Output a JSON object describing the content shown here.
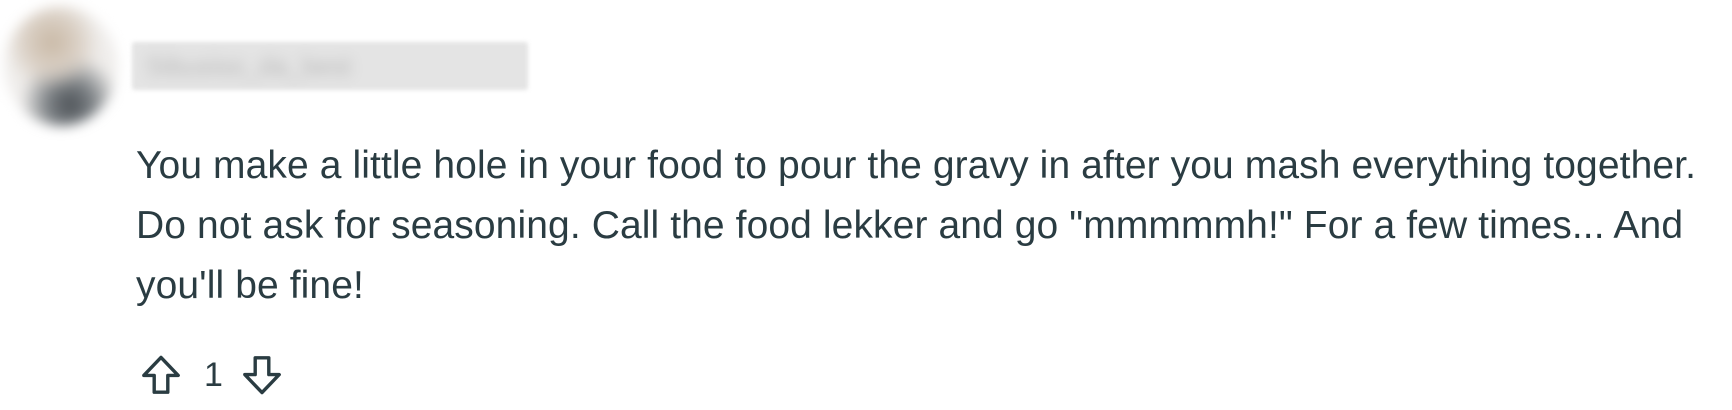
{
  "comment": {
    "author": "Sibusiso_da_best",
    "body": "You make a little hole in your food to pour the gravy in after you mash everything together. Do not ask for seasoning. Call the food lekker and go \"mmmmmh!\" For a few times... And you'll be fine!",
    "votes": {
      "upvote_icon": "upvote-arrow-icon",
      "count": "1",
      "downvote_icon": "downvote-arrow-icon"
    }
  },
  "colors": {
    "text": "#2a3c42",
    "redaction": "#e4e4e4"
  }
}
